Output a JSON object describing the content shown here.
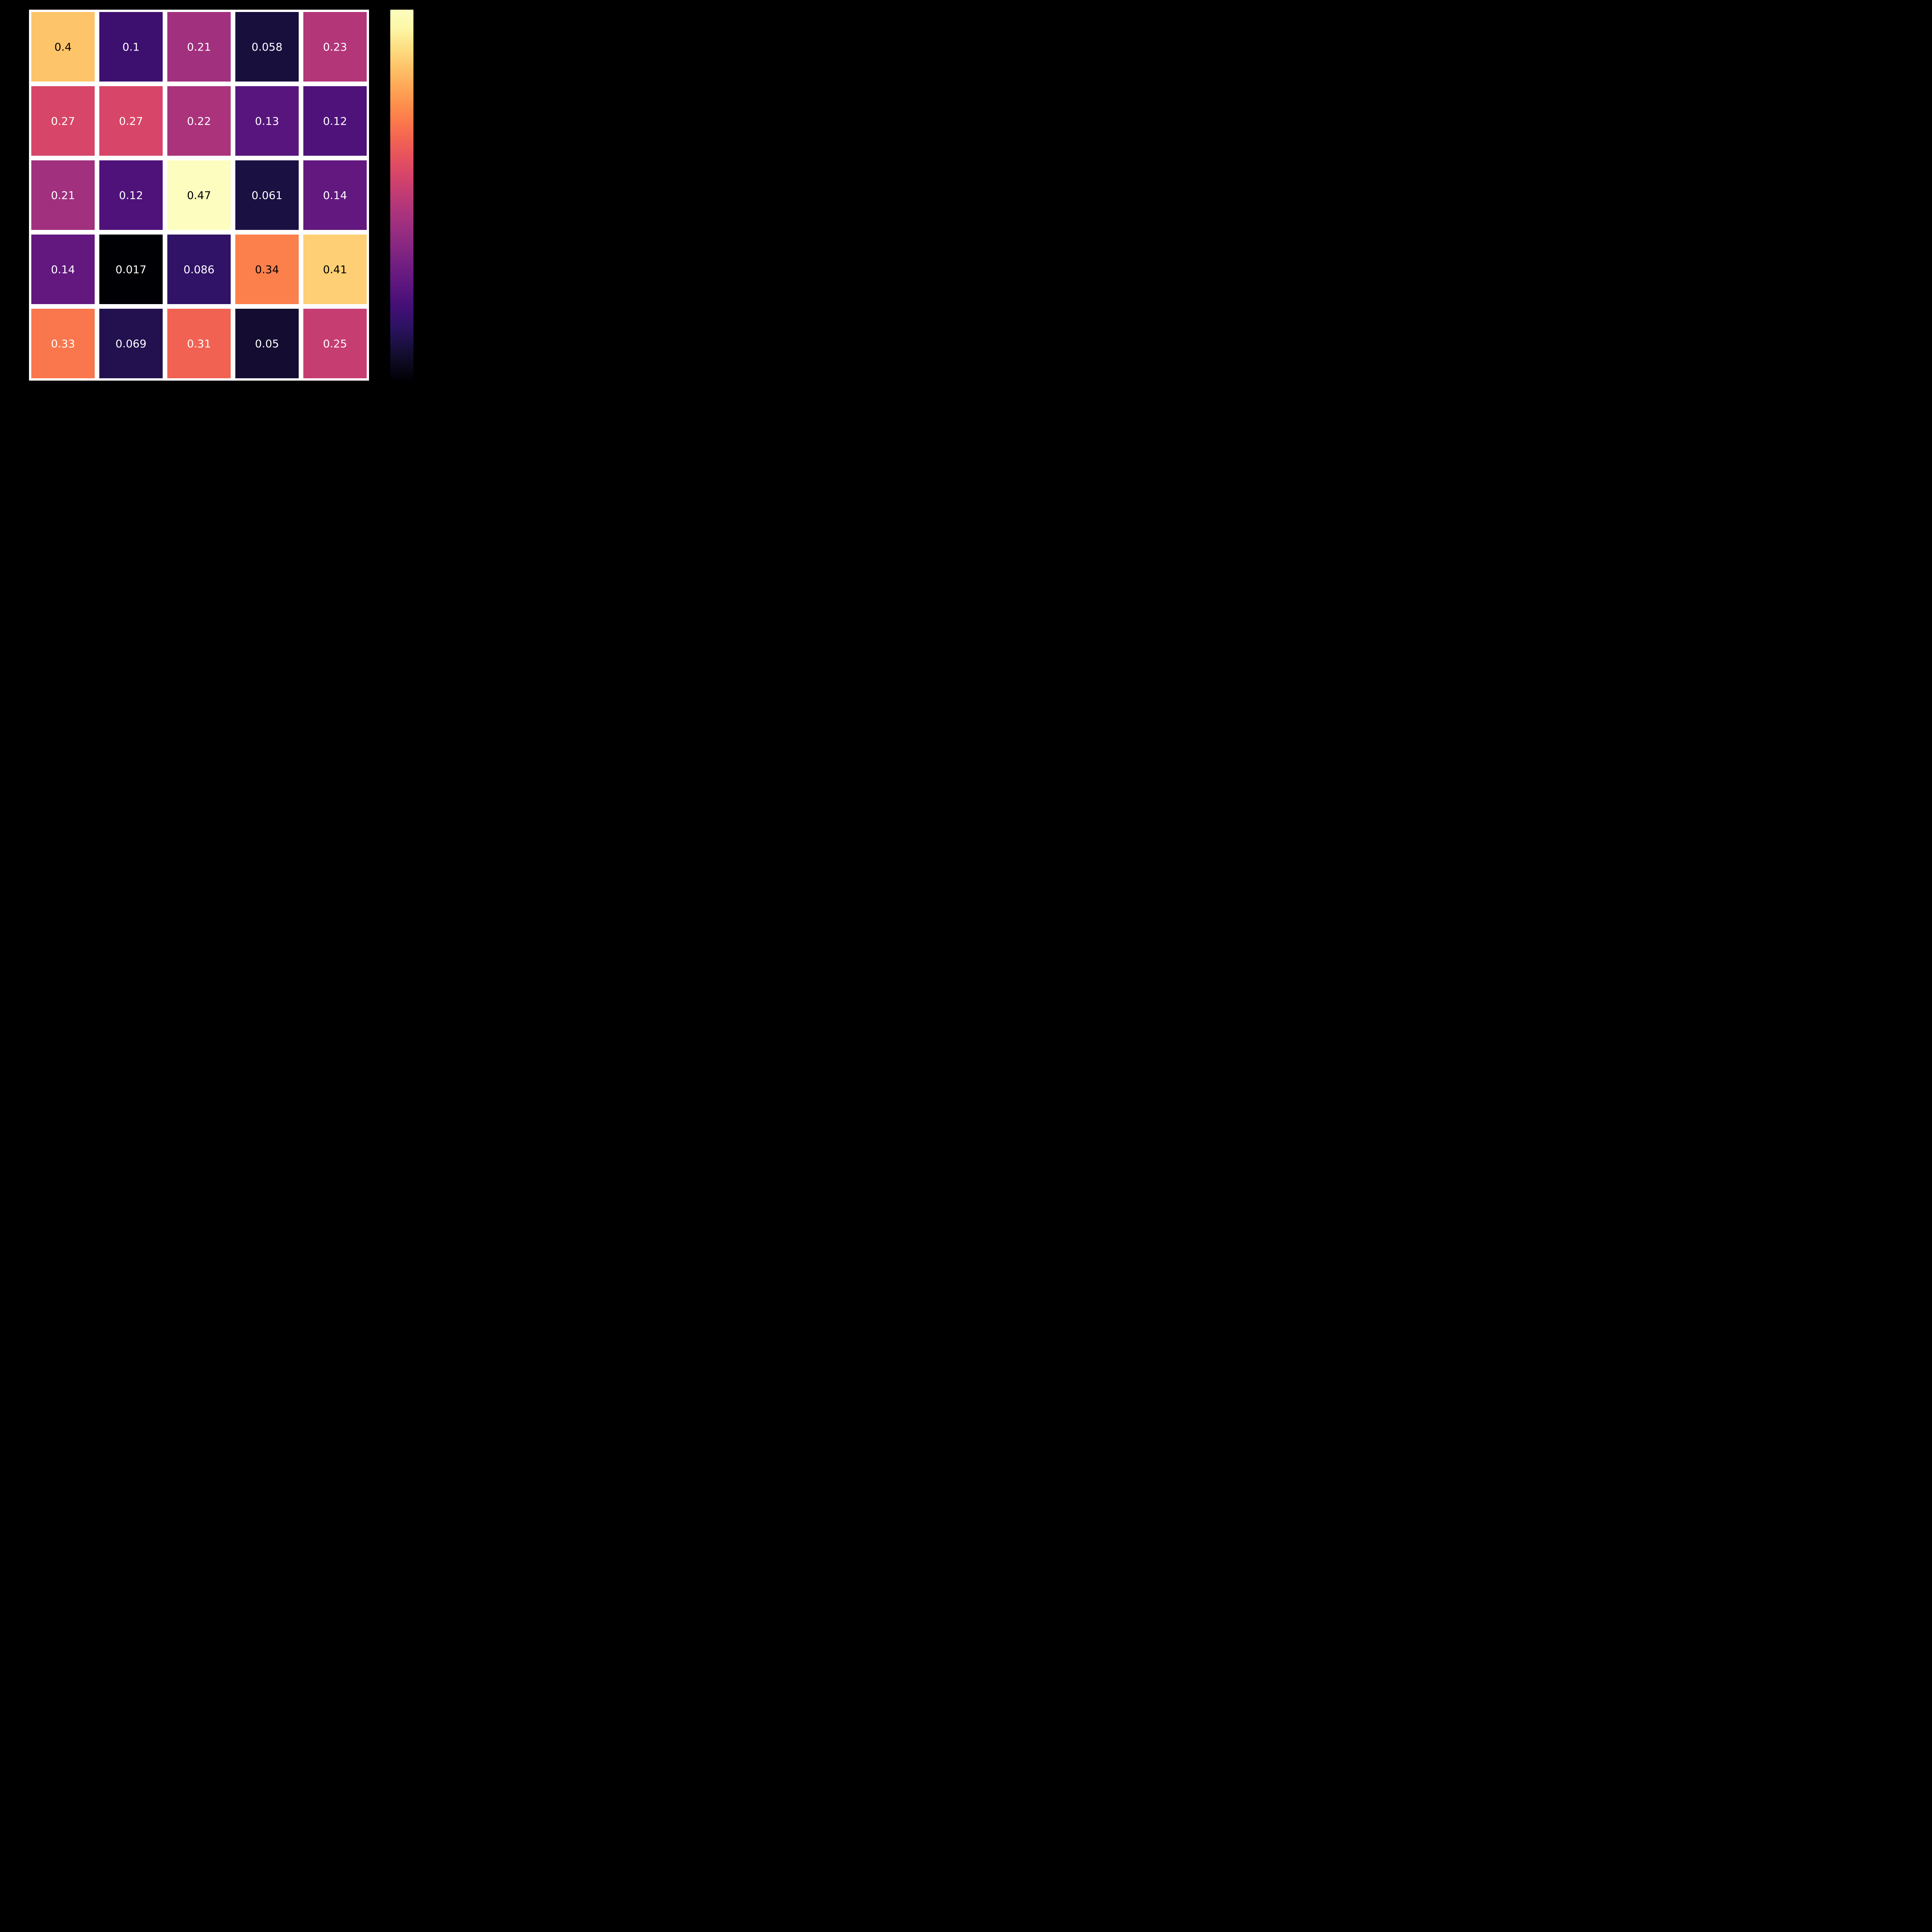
{
  "chart_data": {
    "type": "heatmap",
    "rows": 5,
    "cols": 5,
    "values": [
      [
        0.4,
        0.1,
        0.21,
        0.058,
        0.23
      ],
      [
        0.27,
        0.27,
        0.22,
        0.13,
        0.12
      ],
      [
        0.21,
        0.12,
        0.47,
        0.061,
        0.14
      ],
      [
        0.14,
        0.017,
        0.086,
        0.34,
        0.41
      ],
      [
        0.33,
        0.069,
        0.31,
        0.05,
        0.25
      ]
    ],
    "labels": [
      [
        "0.4",
        "0.1",
        "0.21",
        "0.058",
        "0.23"
      ],
      [
        "0.27",
        "0.27",
        "0.22",
        "0.13",
        "0.12"
      ],
      [
        "0.21",
        "0.12",
        "0.47",
        "0.061",
        "0.14"
      ],
      [
        "0.14",
        "0.017",
        "0.086",
        "0.34",
        "0.41"
      ],
      [
        "0.33",
        "0.069",
        "0.31",
        "0.05",
        "0.25"
      ]
    ],
    "vmin": 0.017,
    "vmax": 0.47,
    "colormap": "magma",
    "gridline_color": "#ffffff",
    "text_threshold": 0.34
  }
}
